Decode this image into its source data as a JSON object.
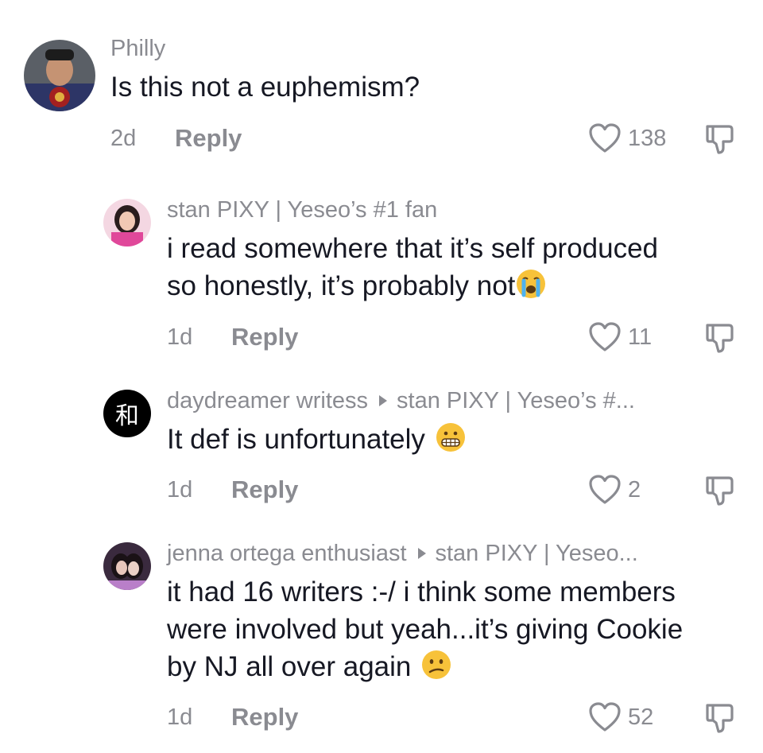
{
  "comments": [
    {
      "username": "Philly",
      "text_lines": [
        "Is this not a euphemism?"
      ],
      "time": "2d",
      "reply_label": "Reply",
      "likes": "138",
      "avatar_icon": "user-avatar-photo"
    },
    {
      "username": "stan PIXY | Yeseo’s #1 fan",
      "text_lines": [
        "i read somewhere that it’s self produced",
        "so honestly, it’s probably not"
      ],
      "emoji": "crying-face-emoji",
      "time": "1d",
      "reply_label": "Reply",
      "likes": "11",
      "avatar_icon": "user-avatar-photo"
    },
    {
      "username": "daydreamer writess",
      "reply_to": "stan PIXY | Yeseo’s #...",
      "text_lines": [
        "It def is unfortunately"
      ],
      "emoji": "grimacing-face-emoji",
      "time": "1d",
      "reply_label": "Reply",
      "likes": "2",
      "avatar_glyph": "和"
    },
    {
      "username": "jenna ortega enthusiast",
      "reply_to": "stan PIXY | Yeseo...",
      "text_lines": [
        "it had 16 writers :-/ i think some members",
        "were involved but yeah...it’s giving Cookie",
        "by NJ all over again"
      ],
      "emoji": "confused-face-emoji",
      "time": "1d",
      "reply_label": "Reply",
      "likes": "52",
      "avatar_icon": "user-avatar-photo"
    }
  ],
  "colors": {
    "text": "#161823",
    "muted": "#8a8b91"
  }
}
